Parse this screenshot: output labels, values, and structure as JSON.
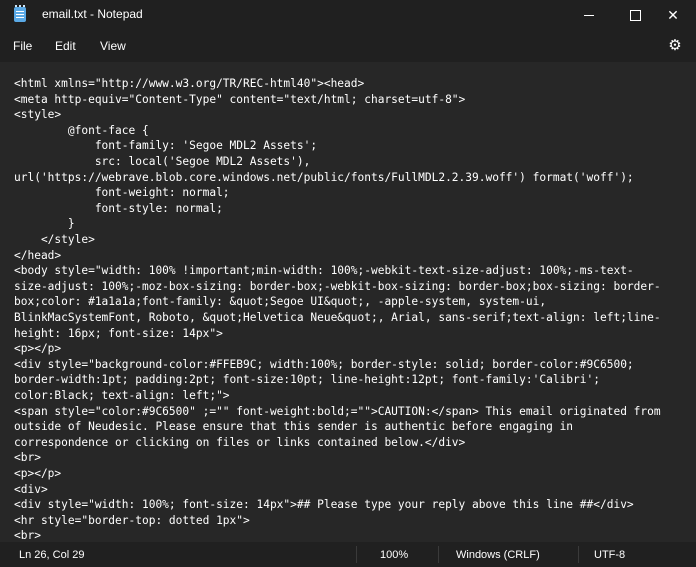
{
  "window": {
    "title": "email.txt - Notepad",
    "close_glyph": "✕"
  },
  "menu": {
    "file": "File",
    "edit": "Edit",
    "view": "View",
    "settings_glyph": "⚙"
  },
  "editor": {
    "lines": [
      "<html xmlns=\"http://www.w3.org/TR/REC-html40\"><head>",
      "<meta http-equiv=\"Content-Type\" content=\"text/html; charset=utf-8\">",
      "<style>",
      "        @font-face {",
      "            font-family: 'Segoe MDL2 Assets';",
      "            src: local('Segoe MDL2 Assets'),",
      "url('https://webrave.blob.core.windows.net/public/fonts/FullMDL2.2.39.woff') format('woff');",
      "            font-weight: normal;",
      "            font-style: normal;",
      "        }",
      "    </style>",
      "</head>",
      "<body style=\"width: 100% !important;min-width: 100%;-webkit-text-size-adjust: 100%;-ms-text-",
      "size-adjust: 100%;-moz-box-sizing: border-box;-webkit-box-sizing: border-box;box-sizing: border-",
      "box;color: #1a1a1a;font-family: &quot;Segoe UI&quot;, -apple-system, system-ui,",
      "BlinkMacSystemFont, Roboto, &quot;Helvetica Neue&quot;, Arial, sans-serif;text-align: left;line-",
      "height: 16px; font-size: 14px\">",
      "<p></p>",
      "<div style=\"background-color:#FFEB9C; width:100%; border-style: solid; border-color:#9C6500;",
      "border-width:1pt; padding:2pt; font-size:10pt; line-height:12pt; font-family:'Calibri';",
      "color:Black; text-align: left;\">",
      "<span style=\"color:#9C6500\" ;=\"\" font-weight:bold;=\"\">CAUTION:</span> This email originated from",
      "outside of Neudesic. Please ensure that this sender is authentic before engaging in",
      "correspondence or clicking on files or links contained below.</div>",
      "<br>",
      "<p></p>",
      "<div>",
      "<div style=\"width: 100%; font-size: 14px\">## Please type your reply above this line ##</div>",
      "<hr style=\"border-top: dotted 1px\">",
      "<br>"
    ]
  },
  "status": {
    "position": "Ln 26, Col 29",
    "zoom": "100%",
    "line_endings": "Windows (CRLF)",
    "encoding": "UTF-8"
  }
}
